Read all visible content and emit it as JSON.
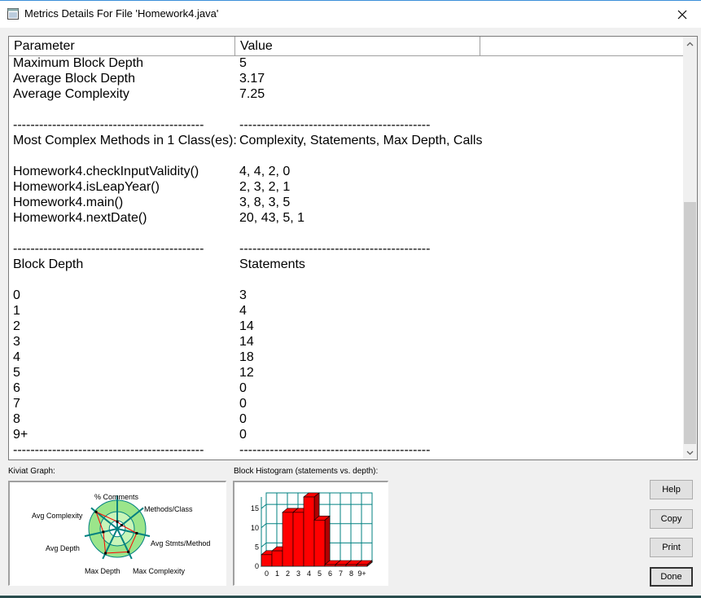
{
  "window": {
    "title": "Metrics Details For File 'Homework4.java'",
    "icon": "window-app-icon",
    "close_icon": "close-icon"
  },
  "table": {
    "columns": [
      "Parameter",
      "Value"
    ],
    "rows": [
      {
        "param": "Maximum Block Depth",
        "value": "5"
      },
      {
        "param": "Average Block Depth",
        "value": "3.17"
      },
      {
        "param": "Average Complexity",
        "value": "7.25"
      },
      {
        "param": "",
        "value": ""
      },
      {
        "param": "--------------------------------------------",
        "value": "--------------------------------------------"
      },
      {
        "param": "Most Complex Methods in 1 Class(es):",
        "value": "Complexity, Statements, Max Depth, Calls"
      },
      {
        "param": "",
        "value": ""
      },
      {
        "param": "Homework4.checkInputValidity()",
        "value": "4, 4, 2, 0"
      },
      {
        "param": "Homework4.isLeapYear()",
        "value": "2, 3, 2, 1"
      },
      {
        "param": "Homework4.main()",
        "value": "3, 8, 3, 5"
      },
      {
        "param": "Homework4.nextDate()",
        "value": "20, 43, 5, 1"
      },
      {
        "param": "",
        "value": ""
      },
      {
        "param": "--------------------------------------------",
        "value": "--------------------------------------------"
      },
      {
        "param": "Block Depth",
        "value": "Statements"
      },
      {
        "param": "",
        "value": ""
      },
      {
        "param": "0",
        "value": "3"
      },
      {
        "param": "1",
        "value": "4"
      },
      {
        "param": "2",
        "value": "14"
      },
      {
        "param": "3",
        "value": "14"
      },
      {
        "param": "4",
        "value": "18"
      },
      {
        "param": "5",
        "value": "12"
      },
      {
        "param": "6",
        "value": "0"
      },
      {
        "param": "7",
        "value": "0"
      },
      {
        "param": "8",
        "value": "0"
      },
      {
        "param": "9+",
        "value": "0"
      },
      {
        "param": "--------------------------------------------",
        "value": "--------------------------------------------"
      }
    ]
  },
  "kiviat": {
    "caption": "Kiviat Graph:",
    "axes": [
      "% Comments",
      "Methods/Class",
      "Avg Stmts/Method",
      "Max Complexity",
      "Max Depth",
      "Avg Depth",
      "Avg Complexity"
    ],
    "values": [
      0.25,
      0.2,
      0.7,
      0.9,
      0.95,
      0.5,
      0.95
    ],
    "colors": {
      "ring_outer": "#ffffff",
      "ring_inner": "#9be58b",
      "spoke": "#008080",
      "poly": "#ff0000"
    }
  },
  "histogram": {
    "caption": "Block Histogram (statements vs. depth):",
    "categories": [
      "0",
      "1",
      "2",
      "3",
      "4",
      "5",
      "6",
      "7",
      "8",
      "9+"
    ],
    "values": [
      3,
      4,
      14,
      14,
      18,
      12,
      0,
      0,
      0,
      0
    ],
    "y_ticks": [
      "0",
      "5",
      "10",
      "15"
    ],
    "ylim": [
      0,
      18
    ],
    "colors": {
      "bar": "#ff0000",
      "bar_side": "#b00000",
      "grid": "#008080"
    }
  },
  "buttons": {
    "help": "Help",
    "copy": "Copy",
    "print": "Print",
    "done": "Done"
  }
}
